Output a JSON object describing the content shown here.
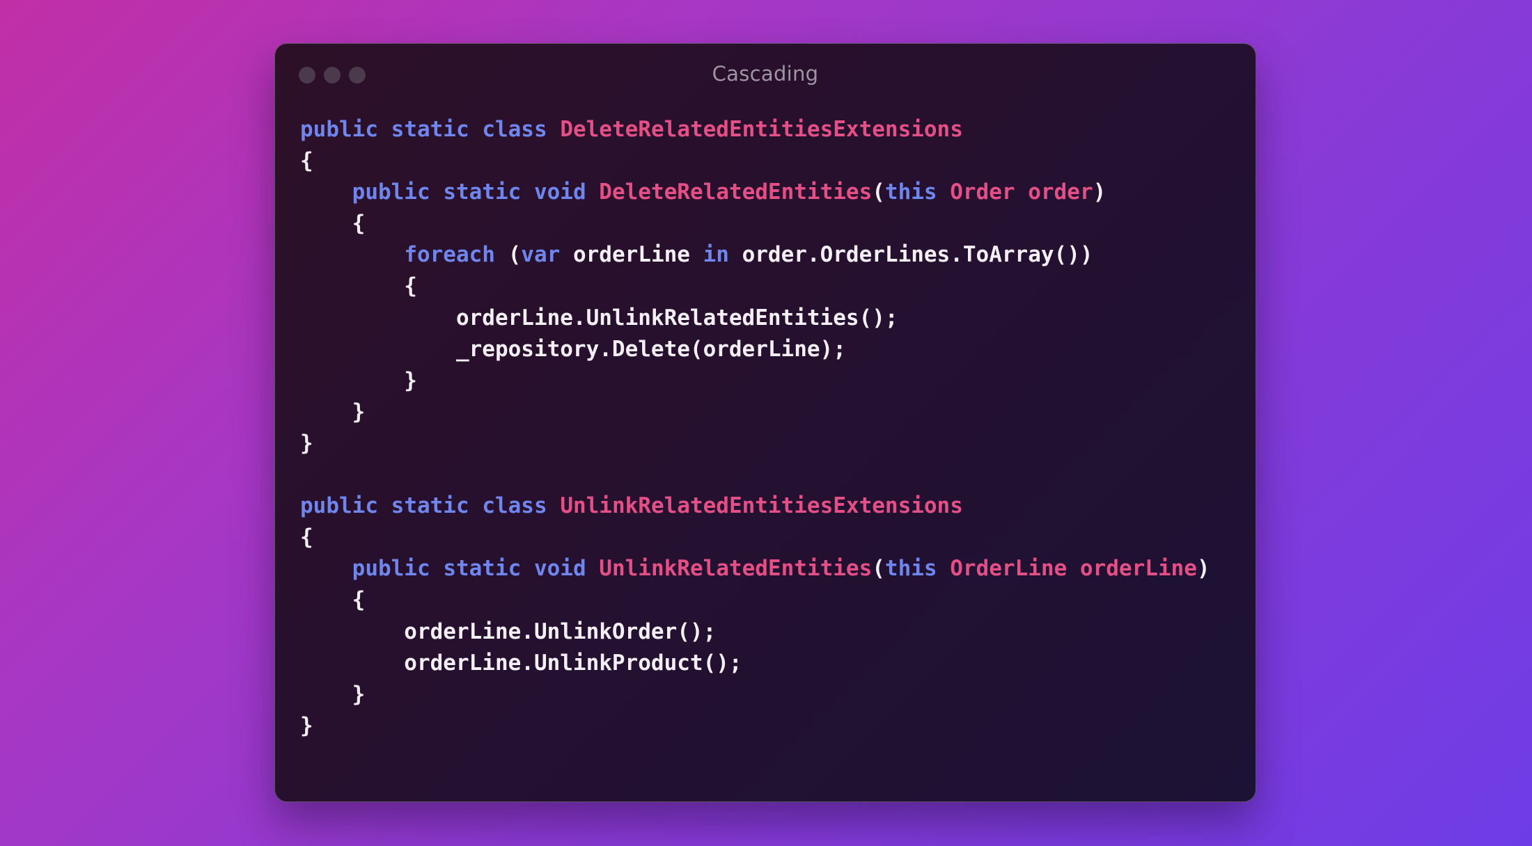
{
  "window": {
    "title": "Cascading",
    "controls": [
      "close",
      "minimize",
      "maximize"
    ]
  },
  "colors": {
    "keyword": "#6f86ee",
    "type": "#e44f86",
    "plain": "#f4f0f6",
    "title": "#9e94a3"
  },
  "code": {
    "lines": [
      [
        [
          "kw",
          "public"
        ],
        [
          "plain",
          " "
        ],
        [
          "kw",
          "static"
        ],
        [
          "plain",
          " "
        ],
        [
          "kw",
          "class"
        ],
        [
          "plain",
          " "
        ],
        [
          "type",
          "DeleteRelatedEntitiesExtensions"
        ]
      ],
      [
        [
          "plain",
          "{"
        ]
      ],
      [
        [
          "plain",
          "    "
        ],
        [
          "kw",
          "public"
        ],
        [
          "plain",
          " "
        ],
        [
          "kw",
          "static"
        ],
        [
          "plain",
          " "
        ],
        [
          "kw",
          "void"
        ],
        [
          "plain",
          " "
        ],
        [
          "type",
          "DeleteRelatedEntities"
        ],
        [
          "plain",
          "("
        ],
        [
          "kw",
          "this"
        ],
        [
          "plain",
          " "
        ],
        [
          "type",
          "Order"
        ],
        [
          "plain",
          " "
        ],
        [
          "type",
          "order"
        ],
        [
          "plain",
          ")"
        ]
      ],
      [
        [
          "plain",
          "    {"
        ]
      ],
      [
        [
          "plain",
          "        "
        ],
        [
          "kw",
          "foreach"
        ],
        [
          "plain",
          " ("
        ],
        [
          "kw",
          "var"
        ],
        [
          "plain",
          " orderLine "
        ],
        [
          "kw",
          "in"
        ],
        [
          "plain",
          " order.OrderLines.ToArray())"
        ]
      ],
      [
        [
          "plain",
          "        {"
        ]
      ],
      [
        [
          "plain",
          "            orderLine.UnlinkRelatedEntities();"
        ]
      ],
      [
        [
          "plain",
          "            _repository.Delete(orderLine);"
        ]
      ],
      [
        [
          "plain",
          "        }"
        ]
      ],
      [
        [
          "plain",
          "    }"
        ]
      ],
      [
        [
          "plain",
          "}"
        ]
      ],
      [
        [
          "plain",
          ""
        ]
      ],
      [
        [
          "kw",
          "public"
        ],
        [
          "plain",
          " "
        ],
        [
          "kw",
          "static"
        ],
        [
          "plain",
          " "
        ],
        [
          "kw",
          "class"
        ],
        [
          "plain",
          " "
        ],
        [
          "type",
          "UnlinkRelatedEntitiesExtensions"
        ]
      ],
      [
        [
          "plain",
          "{"
        ]
      ],
      [
        [
          "plain",
          "    "
        ],
        [
          "kw",
          "public"
        ],
        [
          "plain",
          " "
        ],
        [
          "kw",
          "static"
        ],
        [
          "plain",
          " "
        ],
        [
          "kw",
          "void"
        ],
        [
          "plain",
          " "
        ],
        [
          "type",
          "UnlinkRelatedEntities"
        ],
        [
          "plain",
          "("
        ],
        [
          "kw",
          "this"
        ],
        [
          "plain",
          " "
        ],
        [
          "type",
          "OrderLine"
        ],
        [
          "plain",
          " "
        ],
        [
          "type",
          "orderLine"
        ],
        [
          "plain",
          ")"
        ]
      ],
      [
        [
          "plain",
          "    {"
        ]
      ],
      [
        [
          "plain",
          "        orderLine.UnlinkOrder();"
        ]
      ],
      [
        [
          "plain",
          "        orderLine.UnlinkProduct();"
        ]
      ],
      [
        [
          "plain",
          "    }"
        ]
      ],
      [
        [
          "plain",
          "}"
        ]
      ]
    ]
  }
}
